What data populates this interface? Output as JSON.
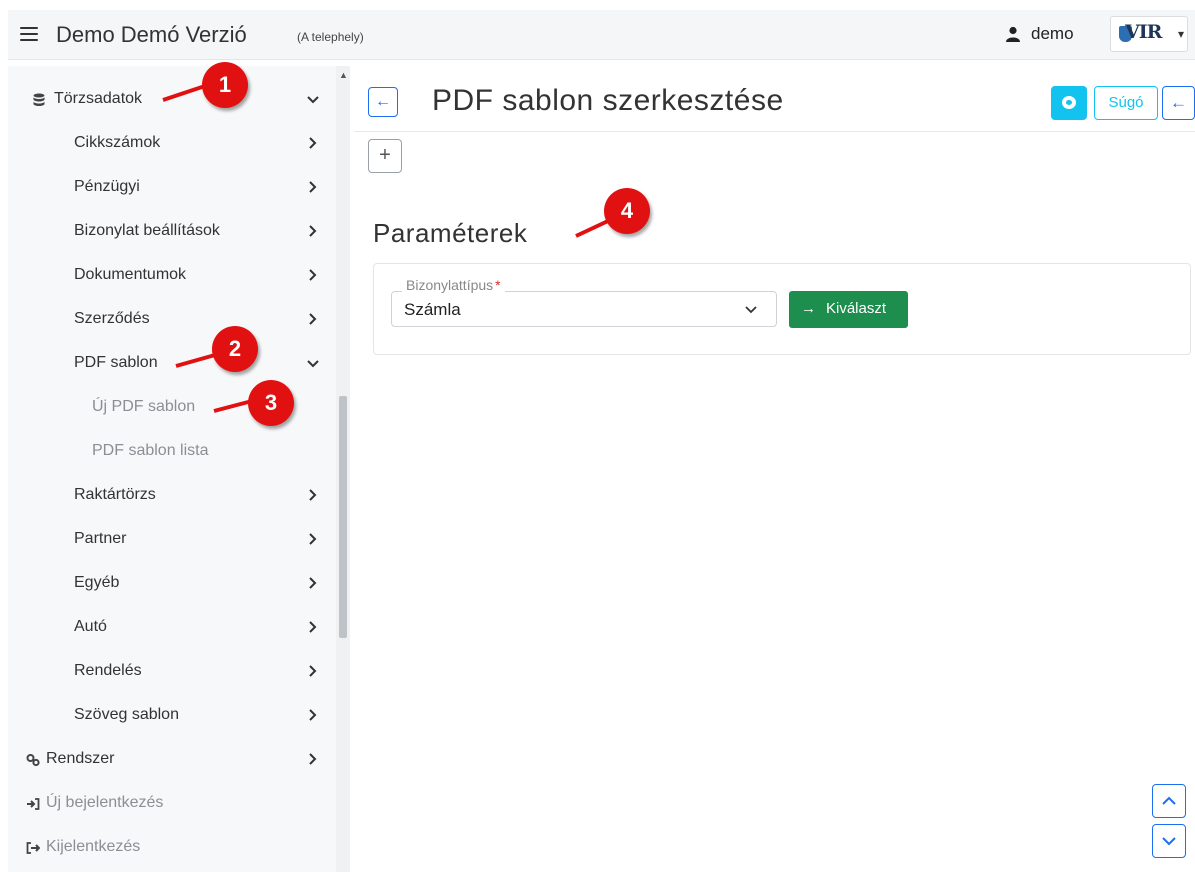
{
  "header": {
    "title": "Demo Demó Verzió",
    "site": "(A telephely)",
    "user": "demo",
    "logo": "VIR"
  },
  "sidebar": {
    "torzsadatok": "Törzsadatok",
    "items": [
      {
        "label": "Cikkszámok"
      },
      {
        "label": "Pénzügyi"
      },
      {
        "label": "Bizonylat beállítások"
      },
      {
        "label": "Dokumentumok"
      },
      {
        "label": "Szerződés"
      },
      {
        "label": "PDF sablon"
      },
      {
        "label": "Új PDF sablon"
      },
      {
        "label": "PDF sablon lista"
      },
      {
        "label": "Raktártörzs"
      },
      {
        "label": "Partner"
      },
      {
        "label": "Egyéb"
      },
      {
        "label": "Autó"
      },
      {
        "label": "Rendelés"
      },
      {
        "label": "Szöveg sablon"
      }
    ],
    "system": "Rendszer",
    "new_login": "Új bejelentkezés",
    "logout": "Kijelentkezés"
  },
  "main": {
    "title": "PDF sablon szerkesztése",
    "help": "Súgó",
    "plus": "+",
    "section": "Paraméterek",
    "field_label": "Bizonylattípus",
    "required_mark": "*",
    "field_value": "Számla",
    "choose": "Kiválaszt"
  },
  "markers": [
    "1",
    "2",
    "3",
    "4"
  ],
  "colors": {
    "accent_blue": "#1c6ef2",
    "help_cyan": "#13c3ef",
    "choose_green": "#1e8e4e",
    "marker_red": "#e21111"
  }
}
